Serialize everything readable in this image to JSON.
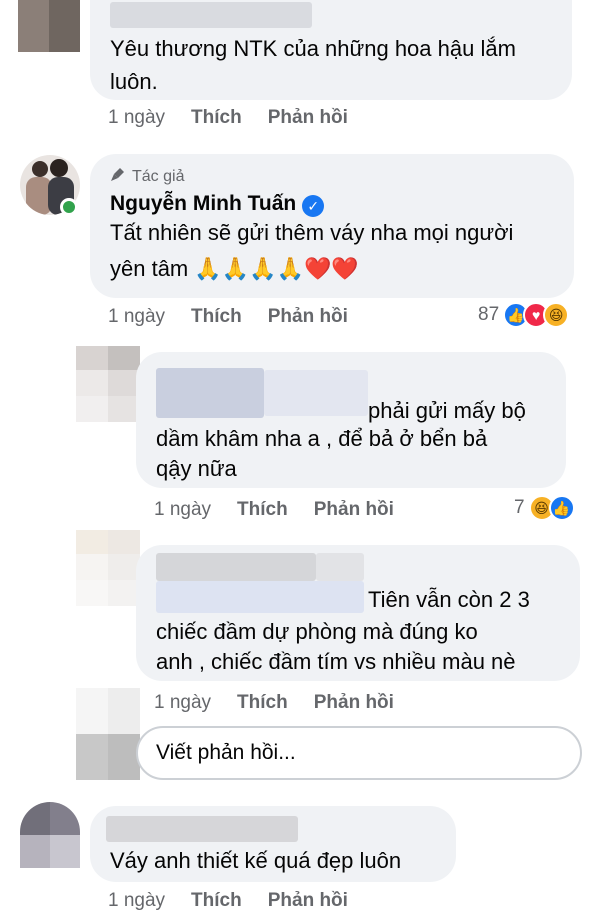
{
  "comments": [
    {
      "text": "Yêu thương NTK của những hoa hậu lắm luôn.",
      "time": "1 ngày",
      "like": "Thích",
      "reply": "Phản hồi"
    },
    {
      "author_tag": "Tác giả",
      "author_name": "Nguyễn Minh Tuấn",
      "text_line1": "Tất nhiên sẽ gửi thêm váy nha mọi người",
      "text_line2": "yên tâm 🙏🙏🙏🙏❤️❤️",
      "time": "1 ngày",
      "like": "Thích",
      "reply": "Phản hồi",
      "reaction_count": "87",
      "reactions": [
        "like-icon",
        "love-icon",
        "haha-icon"
      ]
    },
    {
      "text_line1": "phải gửi mấy bộ",
      "text_line2": "dầm khâm nha a , để bả ở bển bả",
      "text_line3": "qậy nữa",
      "time": "1 ngày",
      "like": "Thích",
      "reply": "Phản hồi",
      "reaction_count": "7",
      "reactions": [
        "haha-icon",
        "like-icon"
      ]
    },
    {
      "text_line1": "Tiên vẫn còn 2 3",
      "text_line2": "chiếc đầm dự phòng mà đúng ko",
      "text_line3": "anh , chiếc đầm tím vs nhiều màu nè",
      "time": "1 ngày",
      "like": "Thích",
      "reply": "Phản hồi"
    },
    {
      "text": "Váy anh thiết kế quá đẹp luôn",
      "time": "1 ngày",
      "like": "Thích",
      "reply": "Phản hồi"
    }
  ],
  "reply_box": {
    "placeholder": "Viết phản hồi..."
  },
  "colors": {
    "bubble": "#f0f2f5",
    "meta_text": "#65676b",
    "verified": "#1877f2",
    "online": "#31a24c"
  }
}
